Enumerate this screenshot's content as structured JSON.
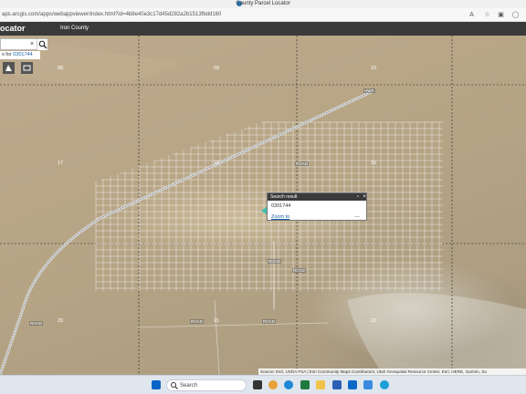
{
  "browser": {
    "tab_title": "County Parcel Locator",
    "url": "aps.arcgis.com/apps/webappviewer/index.html?id=4b8e40e3c17d45d282a2b1513fbdd160"
  },
  "app": {
    "title": "ocator",
    "map_title": "Iron County"
  },
  "search": {
    "value": "",
    "clear_glyph": "×",
    "suggestion_prefix": "s for ",
    "suggestion_value": "0301744"
  },
  "map": {
    "sections": [
      "08",
      "09",
      "10",
      "17",
      "16",
      "15",
      "20",
      "21",
      "22"
    ],
    "road_labels": [
      "HWY",
      "ROAD",
      "ROAD",
      "ROAD",
      "ROAD",
      "ROAD",
      "ROAD"
    ]
  },
  "popup": {
    "title": "Search result",
    "parcel_id": "0301744",
    "zoom_label": "Zoom to",
    "more_label": "..."
  },
  "attribution": "Source: Esri, USDA FSA | Esri Community Maps Contributors, Utah Geospatial Resource Center, Esri, HERE, Garmin, Sa",
  "taskbar": {
    "search_label": "Search"
  },
  "colors": {
    "header": "#3a3a3a",
    "accent": "#3fbfae",
    "link": "#1a5ea8"
  }
}
